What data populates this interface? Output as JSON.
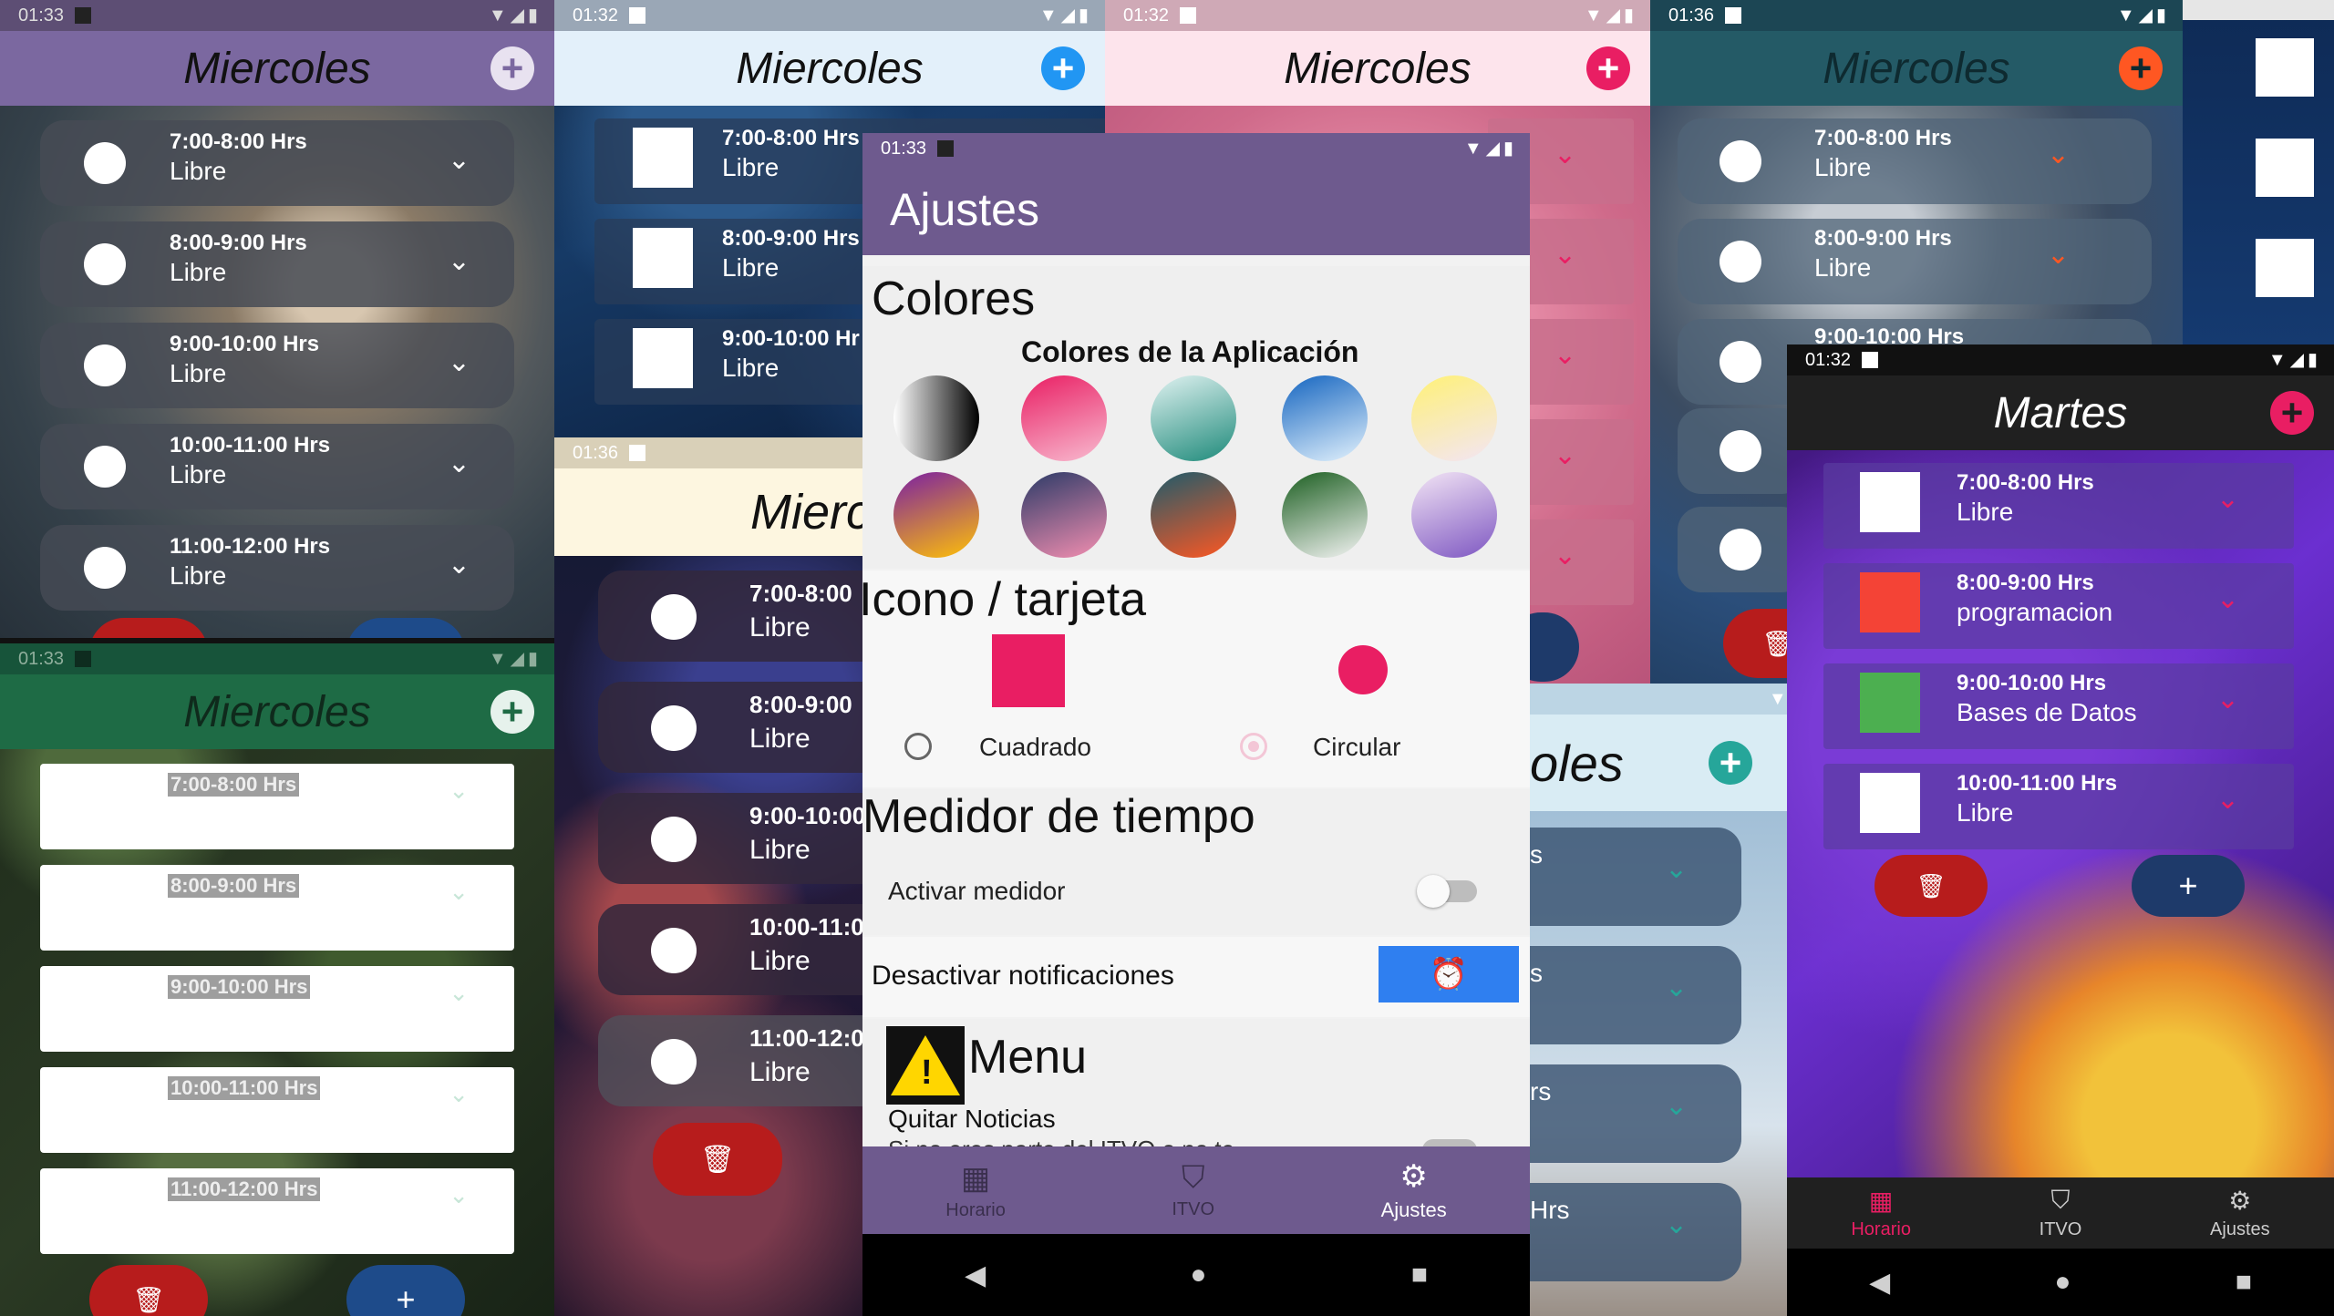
{
  "colors": {
    "purple": "#6e5a8e",
    "green": "#1e6b45",
    "red_pill": "#b71c1c",
    "blue_pill": "#1e4b8a",
    "pink_accent": "#e91e63",
    "blue_accent": "#2196f3",
    "orange_accent": "#ff5722",
    "teal_accent": "#26a69a"
  },
  "screens": {
    "cat": {
      "time": "01:33",
      "title": "Miercoles",
      "slots": [
        {
          "time": "7:00-8:00 Hrs",
          "status": "Libre"
        },
        {
          "time": "8:00-9:00 Hrs",
          "status": "Libre"
        },
        {
          "time": "9:00-10:00 Hrs",
          "status": "Libre"
        },
        {
          "time": "10:00-11:00 Hrs",
          "status": "Libre"
        },
        {
          "time": "11:00-12:00 Hrs",
          "status": "Libre"
        }
      ]
    },
    "green": {
      "time": "01:33",
      "title": "Miercoles",
      "slots": [
        "7:00-8:00 Hrs",
        "8:00-9:00 Hrs",
        "9:00-10:00 Hrs",
        "10:00-11:00 Hrs",
        "11:00-12:00 Hrs"
      ]
    },
    "stars": {
      "time": "01:32",
      "title": "Miercoles",
      "slots": [
        {
          "time": "7:00-8:00 Hrs",
          "status": "Libre"
        },
        {
          "time": "8:00-9:00 Hrs",
          "status": "Libre"
        },
        {
          "time": "9:00-10:00 Hr",
          "status": "Libre"
        }
      ]
    },
    "galaxy": {
      "time": "01:36",
      "title": "Mierc",
      "slots": [
        {
          "time": "7:00-8:00",
          "status": "Libre"
        },
        {
          "time": "8:00-9:00",
          "status": "Libre"
        },
        {
          "time": "9:00-10:00",
          "status": "Libre"
        },
        {
          "time": "10:00-11:0",
          "status": "Libre"
        },
        {
          "time": "11:00-12:0",
          "status": "Libre"
        }
      ]
    },
    "pink": {
      "time": "01:32",
      "title": "Miercoles"
    },
    "space": {
      "time": "01:36",
      "title": "Miercoles",
      "slots": [
        {
          "time": "7:00-8:00 Hrs",
          "status": "Libre"
        },
        {
          "time": "8:00-9:00 Hrs",
          "status": "Libre"
        },
        {
          "time": "9:00-10:00 Hrs",
          "status": ""
        }
      ]
    },
    "sky": {
      "title": "oles",
      "slots": [
        "s",
        "s",
        "rs",
        "Hrs"
      ]
    },
    "martes": {
      "time": "01:32",
      "title": "Martes",
      "slots": [
        {
          "time": "7:00-8:00 Hrs",
          "status": "Libre",
          "color": "#ffffff"
        },
        {
          "time": "8:00-9:00 Hrs",
          "status": "programacion",
          "color": "#f44336"
        },
        {
          "time": "9:00-10:00 Hrs",
          "status": "Bases de Datos",
          "color": "#4caf50"
        },
        {
          "time": "10:00-11:00 Hrs",
          "status": "Libre",
          "color": "#ffffff"
        }
      ],
      "nav": [
        {
          "label": "Horario",
          "icon": "calendar-icon"
        },
        {
          "label": "ITVO",
          "icon": "school-icon"
        },
        {
          "label": "Ajustes",
          "icon": "gear-icon"
        }
      ]
    }
  },
  "settings": {
    "time": "01:33",
    "title": "Ajustes",
    "colors_heading": "Colores",
    "colors_subheading": "Colores de la Aplicación",
    "swatches": [
      "linear-gradient(90deg,#fff,#000)",
      "linear-gradient(160deg,#e91e63,#f8bbd0)",
      "linear-gradient(160deg,#e0f2f1,#1e8a7a)",
      "linear-gradient(160deg,#1565c0,#e3f2fd)",
      "linear-gradient(160deg,#fff176,#f3e5f5)",
      "linear-gradient(160deg,#7b1fa2,#ffc107)",
      "linear-gradient(160deg,#2b3a67,#f48fb1)",
      "linear-gradient(160deg,#1e5b6b,#ff5722)",
      "linear-gradient(160deg,#1b5e20,#f5f5f5)",
      "linear-gradient(160deg,#f3e5f5,#7e57c2)"
    ],
    "shape_heading": "Icono / tarjeta",
    "option_square": "Cuadrado",
    "option_circle": "Circular",
    "timer_heading": "Medidor de tiempo",
    "activate_timer": "Activar medidor",
    "disable_notifications": "Desactivar notificaciones",
    "menu_heading": "Menu",
    "remove_news": "Quitar Noticias",
    "remove_news_desc": "Si no eres parte del ITVO o no te",
    "nav": [
      {
        "label": "Horario",
        "icon": "calendar-icon"
      },
      {
        "label": "ITVO",
        "icon": "school-icon"
      },
      {
        "label": "Ajustes",
        "icon": "gear-icon"
      }
    ]
  }
}
